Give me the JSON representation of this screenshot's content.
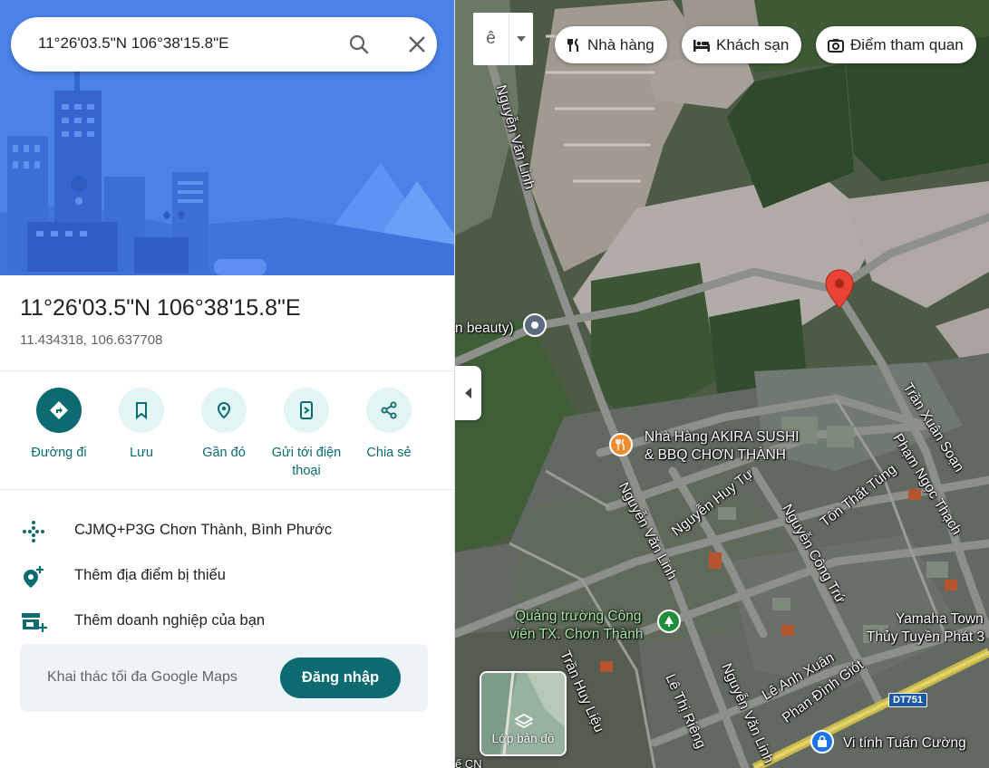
{
  "search": {
    "value": "11°26'03.5\"N 106°38'15.8\"E"
  },
  "place": {
    "title": "11°26'03.5\"N 106°38'15.8\"E",
    "coords": "11.434318, 106.637708"
  },
  "actions": [
    {
      "label": "Đường đi",
      "icon": "directions-icon"
    },
    {
      "label": "Lưu",
      "icon": "bookmark-icon"
    },
    {
      "label": "Gần đó",
      "icon": "nearby-icon"
    },
    {
      "label": "Gửi tới điện thoại",
      "icon": "send-to-phone-icon"
    },
    {
      "label": "Chia sẻ",
      "icon": "share-icon"
    }
  ],
  "info": {
    "pluscode": "CJMQ+P3G Chơn Thành, Bình Phước",
    "add_place": "Thêm địa điểm bị thiếu",
    "add_business": "Thêm doanh nghiệp của bạn"
  },
  "promo": {
    "text": "Khai thác tối đa Google Maps",
    "login": "Đăng nhập"
  },
  "map": {
    "travel_mode_icon": "ê",
    "chips": [
      {
        "label": "Nhà hàng",
        "icon": "restaurant-icon"
      },
      {
        "label": "Khách sạn",
        "icon": "hotel-icon"
      },
      {
        "label": "Điểm tham quan",
        "icon": "camera-icon"
      }
    ],
    "layers_label": "Lớp bản đồ",
    "labels": {
      "nguyen_van_linh_top": "Nguyễn Văn Linh",
      "beauty": "n beauty)",
      "akira_1": "Nhà Hàng AKIRA SUSHI",
      "akira_2": "& BBQ CHƠN THÀNH",
      "nguyen_van_linh_mid": "Nguyễn Văn Linh",
      "nguyen_huy_tu": "Nguyễn Huy Tự",
      "nguyen_cong_tru": "Nguyễn Công Trứ",
      "ton_that_tung": "Tôn Thất Tùng",
      "pham_ngoc_thach": "Phạm Ngọc Thạch",
      "tran_xuan_soan": "Trần Xuân Soạn",
      "quang_truong_1": "Quảng trường Công",
      "quang_truong_2": "viên TX. Chơn Thành",
      "tran_huy_lieu": "Trần Huy Liệu",
      "le_thi_rieng": "Lê Thị Riêng",
      "nguyen_van_linh_bot": "Nguyễn Văn Linh",
      "le_anh_xuan": "Lê Anh Xuân",
      "phan_dinh_giot": "Phan Đình Giót",
      "yamaha_1": "Yamaha Town",
      "yamaha_2": "Thủy Tuyền Phát 3",
      "vi_tinh": "Vi tính Tuấn Cường",
      "dt751": "DT751",
      "cn": "ế CN"
    }
  },
  "colors": {
    "accent": "#0b6b70",
    "accent_light": "#e2f4f4",
    "pin": "#ea4335",
    "hero": "#4a82ea"
  }
}
